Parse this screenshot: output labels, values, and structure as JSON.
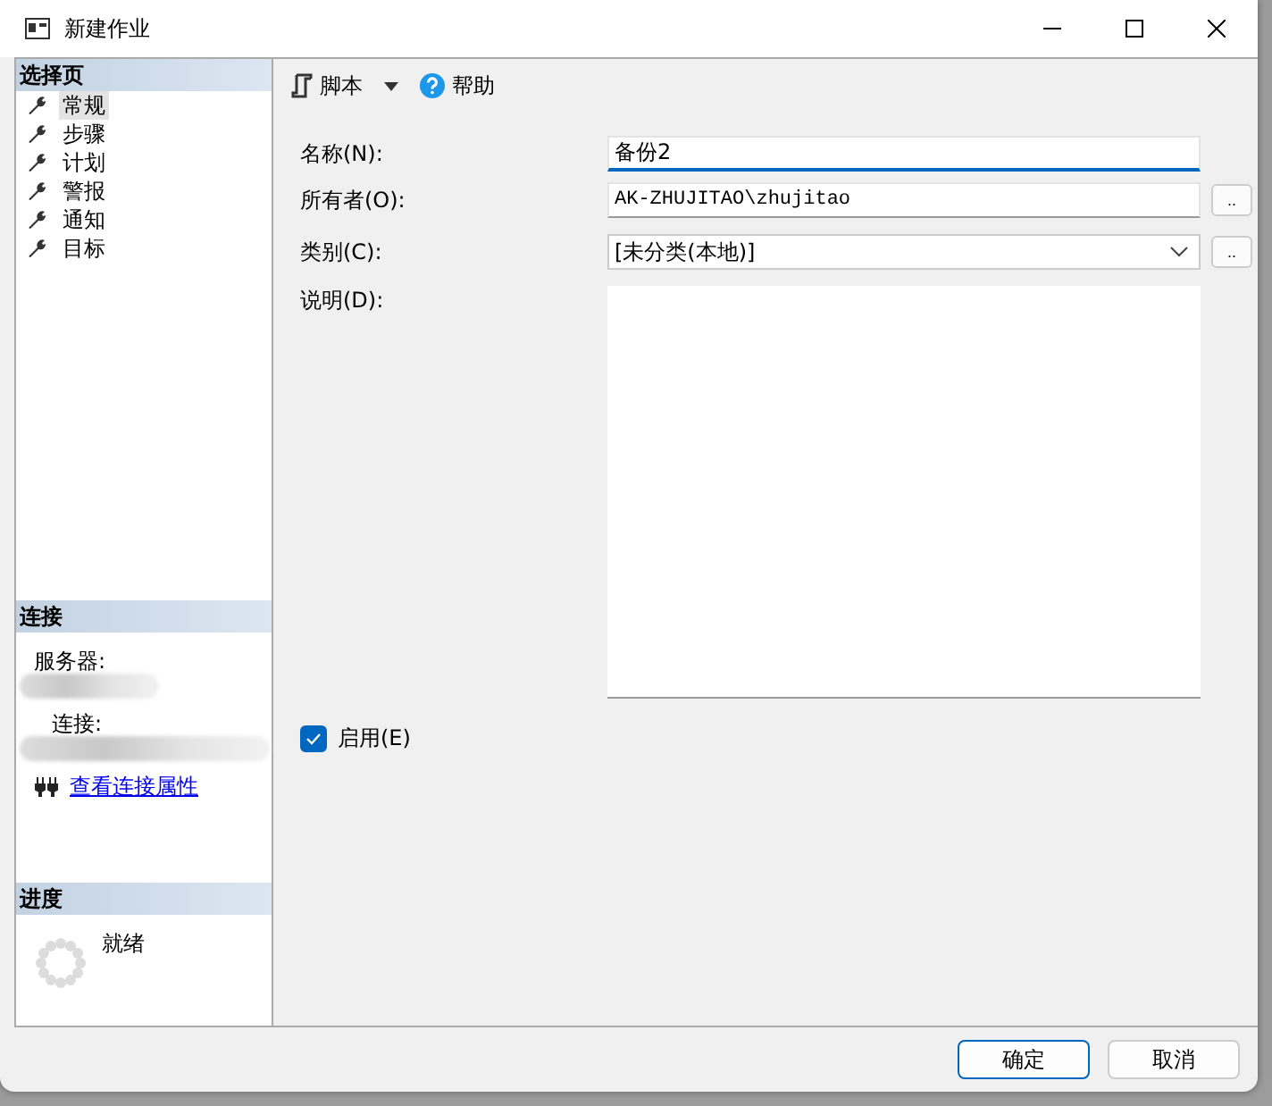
{
  "window": {
    "title": "新建作业"
  },
  "select_page": {
    "title": "选择页",
    "items": [
      {
        "label": "常规",
        "selected": true
      },
      {
        "label": "步骤",
        "selected": false
      },
      {
        "label": "计划",
        "selected": false
      },
      {
        "label": "警报",
        "selected": false
      },
      {
        "label": "通知",
        "selected": false
      },
      {
        "label": "目标",
        "selected": false
      }
    ]
  },
  "connection": {
    "title": "连接",
    "server_label": "服务器:",
    "connection_label": "连接:",
    "link": "查看连接属性"
  },
  "progress": {
    "title": "进度",
    "status": "就绪"
  },
  "toolbar": {
    "script": "脚本",
    "help": "帮助"
  },
  "form": {
    "name_label": "名称(N):",
    "name_value": "备份2",
    "owner_label": "所有者(O):",
    "owner_value": "AK-ZHUJITAO\\zhujitao",
    "browse": "..",
    "category_label": "类别(C):",
    "category_value": "[未分类(本地)]",
    "category_browse": "..",
    "description_label": "说明(D):",
    "enabled_label": "启用(E)",
    "enabled": true
  },
  "buttons": {
    "ok": "确定",
    "cancel": "取消"
  }
}
